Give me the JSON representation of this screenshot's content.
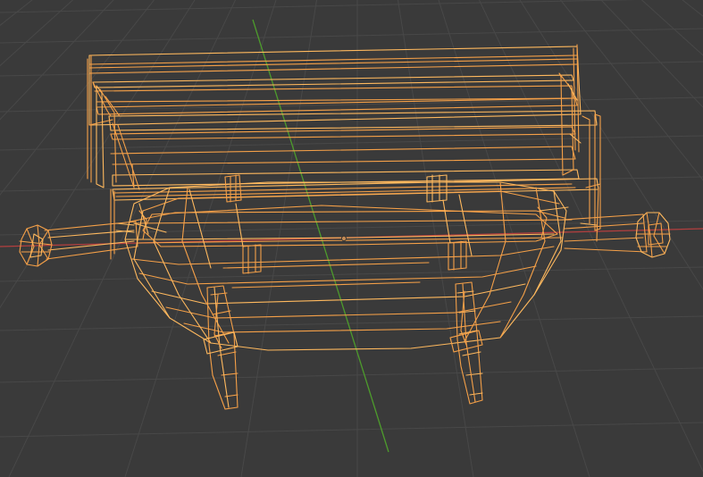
{
  "app": {
    "name": "3D Viewport",
    "mode": "wireframe"
  },
  "viewport": {
    "background_color": "#3a3a3a",
    "grid_color": "#484848",
    "x_axis_color": "#b33f3f",
    "y_axis_color": "#4d9b2c"
  },
  "selection": {
    "wire_color": "#f5a048",
    "wire_highlight": "#ffb95e",
    "origin_color": "#c18a55",
    "object_selected": true
  }
}
